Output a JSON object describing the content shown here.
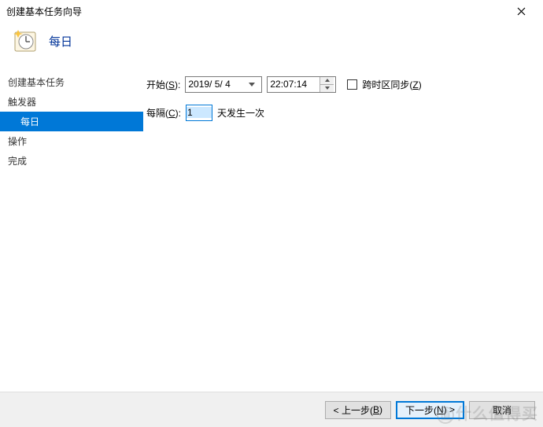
{
  "window": {
    "title": "创建基本任务向导"
  },
  "header": {
    "title": "每日"
  },
  "sidebar": {
    "items": [
      {
        "label": "创建基本任务"
      },
      {
        "label": "触发器"
      },
      {
        "label": "每日"
      },
      {
        "label": "操作"
      },
      {
        "label": "完成"
      }
    ]
  },
  "form": {
    "start_label_a": "开始(",
    "start_label_hot": "S",
    "start_label_b": "):",
    "date_value": "2019/ 5/ 4",
    "time_value": "22:07:14",
    "sync_label_a": "跨时区同步(",
    "sync_label_hot": "Z",
    "sync_label_b": ")",
    "sync_checked": false,
    "recur_label_a": "每隔(",
    "recur_label_hot": "C",
    "recur_label_b": "):",
    "recur_value": "1",
    "recur_suffix": "天发生一次"
  },
  "buttons": {
    "back_a": "< 上一步(",
    "back_hot": "B",
    "back_b": ")",
    "next_a": "下一步(",
    "next_hot": "N",
    "next_b": ") >",
    "cancel": "取消"
  },
  "watermark": "什么值得买"
}
